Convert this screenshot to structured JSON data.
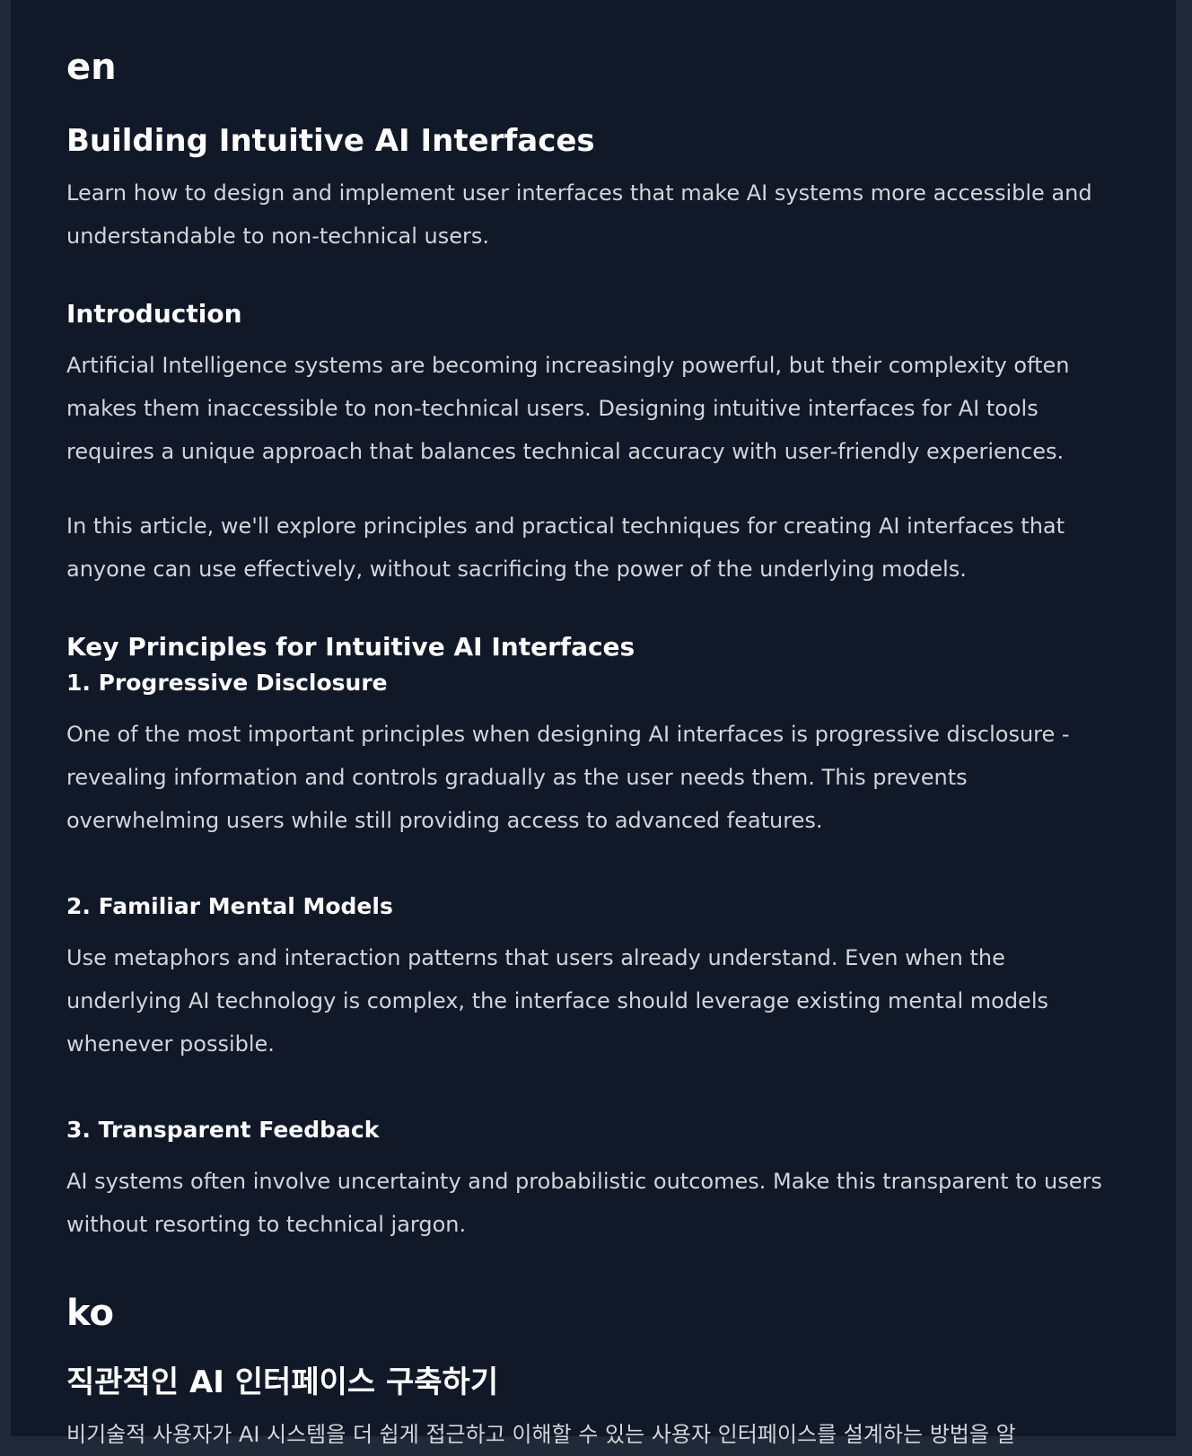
{
  "en": {
    "lang_label": "en",
    "title": "Building Intuitive AI Interfaces",
    "summary": "Learn how to design and implement user interfaces that make AI systems more accessible and understandable to non-technical users.",
    "introduction": {
      "heading": "Introduction",
      "paragraphs": [
        "Artificial Intelligence systems are becoming increasingly powerful, but their complexity often makes them inaccessible to non-technical users. Designing intuitive interfaces for AI tools requires a unique approach that balances technical accuracy with user-friendly experiences.",
        "In this article, we'll explore principles and practical techniques for creating AI interfaces that anyone can use effectively, without sacrificing the power of the underlying models."
      ]
    },
    "principles": {
      "heading": "Key Principles for Intuitive AI Interfaces",
      "items": [
        {
          "title": "1. Progressive Disclosure",
          "body": "One of the most important principles when designing AI interfaces is progressive disclosure - revealing information and controls gradually as the user needs them. This prevents overwhelming users while still providing access to advanced features."
        },
        {
          "title": "2. Familiar Mental Models",
          "body": "Use metaphors and interaction patterns that users already understand. Even when the underlying AI technology is complex, the interface should leverage existing mental models whenever possible."
        },
        {
          "title": "3. Transparent Feedback",
          "body": "AI systems often involve uncertainty and probabilistic outcomes. Make this transparent to users without resorting to technical jargon."
        }
      ]
    }
  },
  "ko": {
    "lang_label": "ko",
    "title": "직관적인 AI 인터페이스 구축하기",
    "summary": "비기술적 사용자가 AI 시스템을 더 쉽게 접근하고 이해할 수 있는 사용자 인터페이스를 설계하는 방법을 알"
  }
}
